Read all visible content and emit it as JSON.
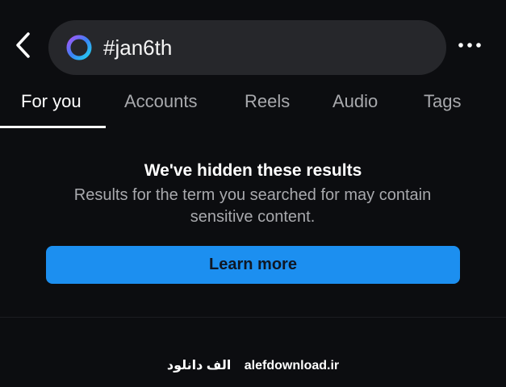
{
  "header": {
    "back_icon": "chevron-left-icon",
    "search": {
      "value": "#jan6th",
      "ring_colors": [
        "#a855f7",
        "#3b82f6",
        "#22d3ee"
      ]
    },
    "more_icon": "more-horizontal-icon"
  },
  "tabs": [
    {
      "label": "For you",
      "active": true
    },
    {
      "label": "Accounts",
      "active": false
    },
    {
      "label": "Reels",
      "active": false
    },
    {
      "label": "Audio",
      "active": false
    },
    {
      "label": "Tags",
      "active": false
    }
  ],
  "notice": {
    "title": "We've hidden these results",
    "body": "Results for the term you searched for may contain sensitive content."
  },
  "learn_more": {
    "label": "Learn more",
    "color": "#1c8ff0"
  },
  "watermark": {
    "persian": "الف دانلود",
    "domain": "alefdownload.ir"
  }
}
